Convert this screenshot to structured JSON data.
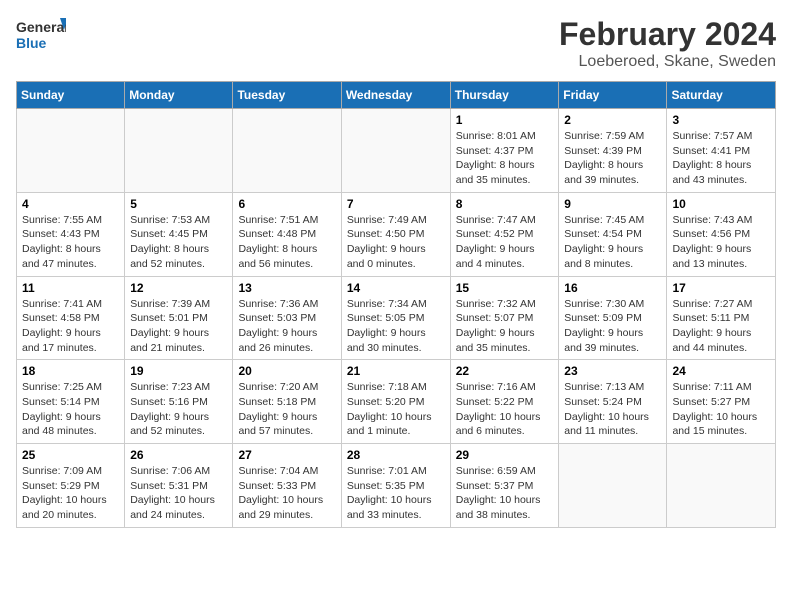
{
  "header": {
    "logo_general": "General",
    "logo_blue": "Blue",
    "month_title": "February 2024",
    "location": "Loeberoed, Skane, Sweden"
  },
  "days_of_week": [
    "Sunday",
    "Monday",
    "Tuesday",
    "Wednesday",
    "Thursday",
    "Friday",
    "Saturday"
  ],
  "weeks": [
    [
      {
        "day": "",
        "info": ""
      },
      {
        "day": "",
        "info": ""
      },
      {
        "day": "",
        "info": ""
      },
      {
        "day": "",
        "info": ""
      },
      {
        "day": "1",
        "info": "Sunrise: 8:01 AM\nSunset: 4:37 PM\nDaylight: 8 hours\nand 35 minutes."
      },
      {
        "day": "2",
        "info": "Sunrise: 7:59 AM\nSunset: 4:39 PM\nDaylight: 8 hours\nand 39 minutes."
      },
      {
        "day": "3",
        "info": "Sunrise: 7:57 AM\nSunset: 4:41 PM\nDaylight: 8 hours\nand 43 minutes."
      }
    ],
    [
      {
        "day": "4",
        "info": "Sunrise: 7:55 AM\nSunset: 4:43 PM\nDaylight: 8 hours\nand 47 minutes."
      },
      {
        "day": "5",
        "info": "Sunrise: 7:53 AM\nSunset: 4:45 PM\nDaylight: 8 hours\nand 52 minutes."
      },
      {
        "day": "6",
        "info": "Sunrise: 7:51 AM\nSunset: 4:48 PM\nDaylight: 8 hours\nand 56 minutes."
      },
      {
        "day": "7",
        "info": "Sunrise: 7:49 AM\nSunset: 4:50 PM\nDaylight: 9 hours\nand 0 minutes."
      },
      {
        "day": "8",
        "info": "Sunrise: 7:47 AM\nSunset: 4:52 PM\nDaylight: 9 hours\nand 4 minutes."
      },
      {
        "day": "9",
        "info": "Sunrise: 7:45 AM\nSunset: 4:54 PM\nDaylight: 9 hours\nand 8 minutes."
      },
      {
        "day": "10",
        "info": "Sunrise: 7:43 AM\nSunset: 4:56 PM\nDaylight: 9 hours\nand 13 minutes."
      }
    ],
    [
      {
        "day": "11",
        "info": "Sunrise: 7:41 AM\nSunset: 4:58 PM\nDaylight: 9 hours\nand 17 minutes."
      },
      {
        "day": "12",
        "info": "Sunrise: 7:39 AM\nSunset: 5:01 PM\nDaylight: 9 hours\nand 21 minutes."
      },
      {
        "day": "13",
        "info": "Sunrise: 7:36 AM\nSunset: 5:03 PM\nDaylight: 9 hours\nand 26 minutes."
      },
      {
        "day": "14",
        "info": "Sunrise: 7:34 AM\nSunset: 5:05 PM\nDaylight: 9 hours\nand 30 minutes."
      },
      {
        "day": "15",
        "info": "Sunrise: 7:32 AM\nSunset: 5:07 PM\nDaylight: 9 hours\nand 35 minutes."
      },
      {
        "day": "16",
        "info": "Sunrise: 7:30 AM\nSunset: 5:09 PM\nDaylight: 9 hours\nand 39 minutes."
      },
      {
        "day": "17",
        "info": "Sunrise: 7:27 AM\nSunset: 5:11 PM\nDaylight: 9 hours\nand 44 minutes."
      }
    ],
    [
      {
        "day": "18",
        "info": "Sunrise: 7:25 AM\nSunset: 5:14 PM\nDaylight: 9 hours\nand 48 minutes."
      },
      {
        "day": "19",
        "info": "Sunrise: 7:23 AM\nSunset: 5:16 PM\nDaylight: 9 hours\nand 52 minutes."
      },
      {
        "day": "20",
        "info": "Sunrise: 7:20 AM\nSunset: 5:18 PM\nDaylight: 9 hours\nand 57 minutes."
      },
      {
        "day": "21",
        "info": "Sunrise: 7:18 AM\nSunset: 5:20 PM\nDaylight: 10 hours\nand 1 minute."
      },
      {
        "day": "22",
        "info": "Sunrise: 7:16 AM\nSunset: 5:22 PM\nDaylight: 10 hours\nand 6 minutes."
      },
      {
        "day": "23",
        "info": "Sunrise: 7:13 AM\nSunset: 5:24 PM\nDaylight: 10 hours\nand 11 minutes."
      },
      {
        "day": "24",
        "info": "Sunrise: 7:11 AM\nSunset: 5:27 PM\nDaylight: 10 hours\nand 15 minutes."
      }
    ],
    [
      {
        "day": "25",
        "info": "Sunrise: 7:09 AM\nSunset: 5:29 PM\nDaylight: 10 hours\nand 20 minutes."
      },
      {
        "day": "26",
        "info": "Sunrise: 7:06 AM\nSunset: 5:31 PM\nDaylight: 10 hours\nand 24 minutes."
      },
      {
        "day": "27",
        "info": "Sunrise: 7:04 AM\nSunset: 5:33 PM\nDaylight: 10 hours\nand 29 minutes."
      },
      {
        "day": "28",
        "info": "Sunrise: 7:01 AM\nSunset: 5:35 PM\nDaylight: 10 hours\nand 33 minutes."
      },
      {
        "day": "29",
        "info": "Sunrise: 6:59 AM\nSunset: 5:37 PM\nDaylight: 10 hours\nand 38 minutes."
      },
      {
        "day": "",
        "info": ""
      },
      {
        "day": "",
        "info": ""
      }
    ]
  ]
}
